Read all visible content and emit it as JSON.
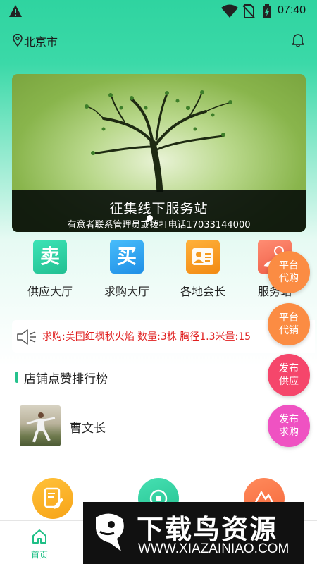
{
  "status_bar": {
    "time": "07:40"
  },
  "header": {
    "city": "北京市"
  },
  "banner": {
    "title": "征集线下服务站",
    "subtitle": "有意者联系管理员或拨打电话17033144000"
  },
  "quick_actions": [
    {
      "glyph": "卖",
      "label": "供应大厅",
      "color": "#2fcfa4"
    },
    {
      "glyph": "买",
      "label": "求购大厅",
      "color": "#2fa6ef"
    },
    {
      "glyph": "",
      "label": "各地会长",
      "color": "#f59a1f"
    },
    {
      "glyph": "",
      "label": "服务站",
      "color": "#f2735b"
    }
  ],
  "notice": {
    "text": "求购:美国红枫秋火焰 数量:3株 胸径1.3米量:15"
  },
  "ranking": {
    "title": "店铺点赞排行榜",
    "shops": [
      {
        "name": "曹文长"
      }
    ]
  },
  "floating_buttons": [
    {
      "label": "平台代购",
      "line1": "平台",
      "line2": "代购",
      "color": "#fb8c43"
    },
    {
      "label": "平台代销",
      "line1": "平台",
      "line2": "代销",
      "color": "#fb8c43"
    },
    {
      "label": "发布供应",
      "line1": "发布",
      "line2": "供应",
      "color": "#f5466b"
    },
    {
      "label": "发布求购",
      "line1": "发布",
      "line2": "求购",
      "color": "#ef52c2"
    }
  ],
  "tabbar": {
    "tabs": [
      {
        "label": "首页"
      },
      {
        "label": ""
      },
      {
        "label": ""
      },
      {
        "label": ""
      }
    ]
  },
  "watermark": {
    "title": "下载鸟资源",
    "url": "WWW.XIAZAINIAO.COM"
  },
  "colors": {
    "brand": "#2fd4a0",
    "active_tab": "#1fbf86",
    "notice_text": "#e02020"
  }
}
